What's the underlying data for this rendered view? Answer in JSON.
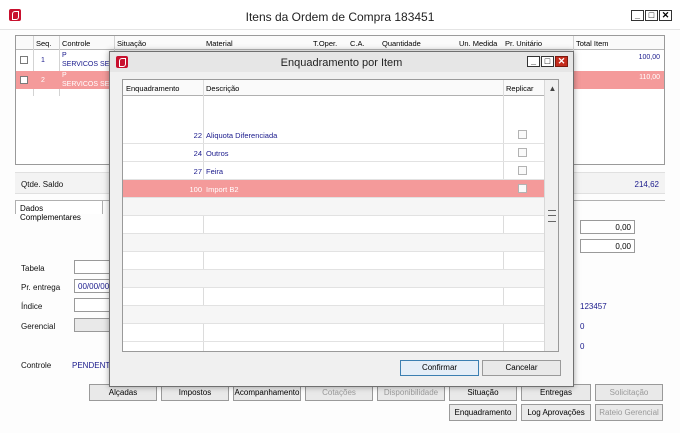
{
  "main": {
    "title": "Itens da Ordem de Compra 183451",
    "columns": [
      "Seq.",
      "Controle",
      "Situação",
      "Material",
      "T.Oper.",
      "C.A.",
      "Quantidade",
      "Un. Medida",
      "Pr. Unitário",
      "Total Item"
    ],
    "rows": [
      {
        "seq": "1",
        "controle_line1": "P",
        "controle_line2": "SERVICOS SER",
        "total": "100,00"
      },
      {
        "seq": "2",
        "controle_line1": "P",
        "controle_line2": "SERVICOS SER",
        "total": "110,00"
      }
    ],
    "qtde_saldo_label": "Qtde. Saldo",
    "qtde_saldo_value": "214,62",
    "tab_label": "Dados Complementares",
    "tabela_label": "Tabela",
    "pr_entrega_label": "Pr. entrega",
    "pr_entrega_value": "00/00/00",
    "indice_label": "Índice",
    "gerencial_label": "Gerencial",
    "controle_label": "Controle",
    "controle_value": "PENDENTE",
    "right_value_1": "0,00",
    "right_value_2": "0,00",
    "right_code": "123457",
    "right_zero_1": "0",
    "right_zero_2": "0",
    "buttons_row1": [
      "Alçadas",
      "Impostos",
      "Acompanhamento",
      "Cotações",
      "Disponibilidade",
      "Situação",
      "Entregas",
      "Solicitação"
    ],
    "buttons_row2": [
      "Enquadramento",
      "Log Aprovações",
      "Rateio Gerencial"
    ]
  },
  "dialog": {
    "title": "Enquadramento por Item",
    "col_enquadramento": "Enquadramento",
    "col_descricao": "Descrição",
    "col_replicar": "Replicar",
    "rows": [
      {
        "code": "22",
        "desc": "Aliquota Diferenciada"
      },
      {
        "code": "24",
        "desc": "Outros"
      },
      {
        "code": "27",
        "desc": "Feira"
      },
      {
        "code": "100",
        "desc": "Import B2"
      }
    ],
    "confirm_label": "Confirmar",
    "cancel_label": "Cancelar"
  },
  "colors": {
    "selection": "#f49a9a",
    "link_text": "#1a1a8c",
    "brand_icon": "#c8102e"
  }
}
